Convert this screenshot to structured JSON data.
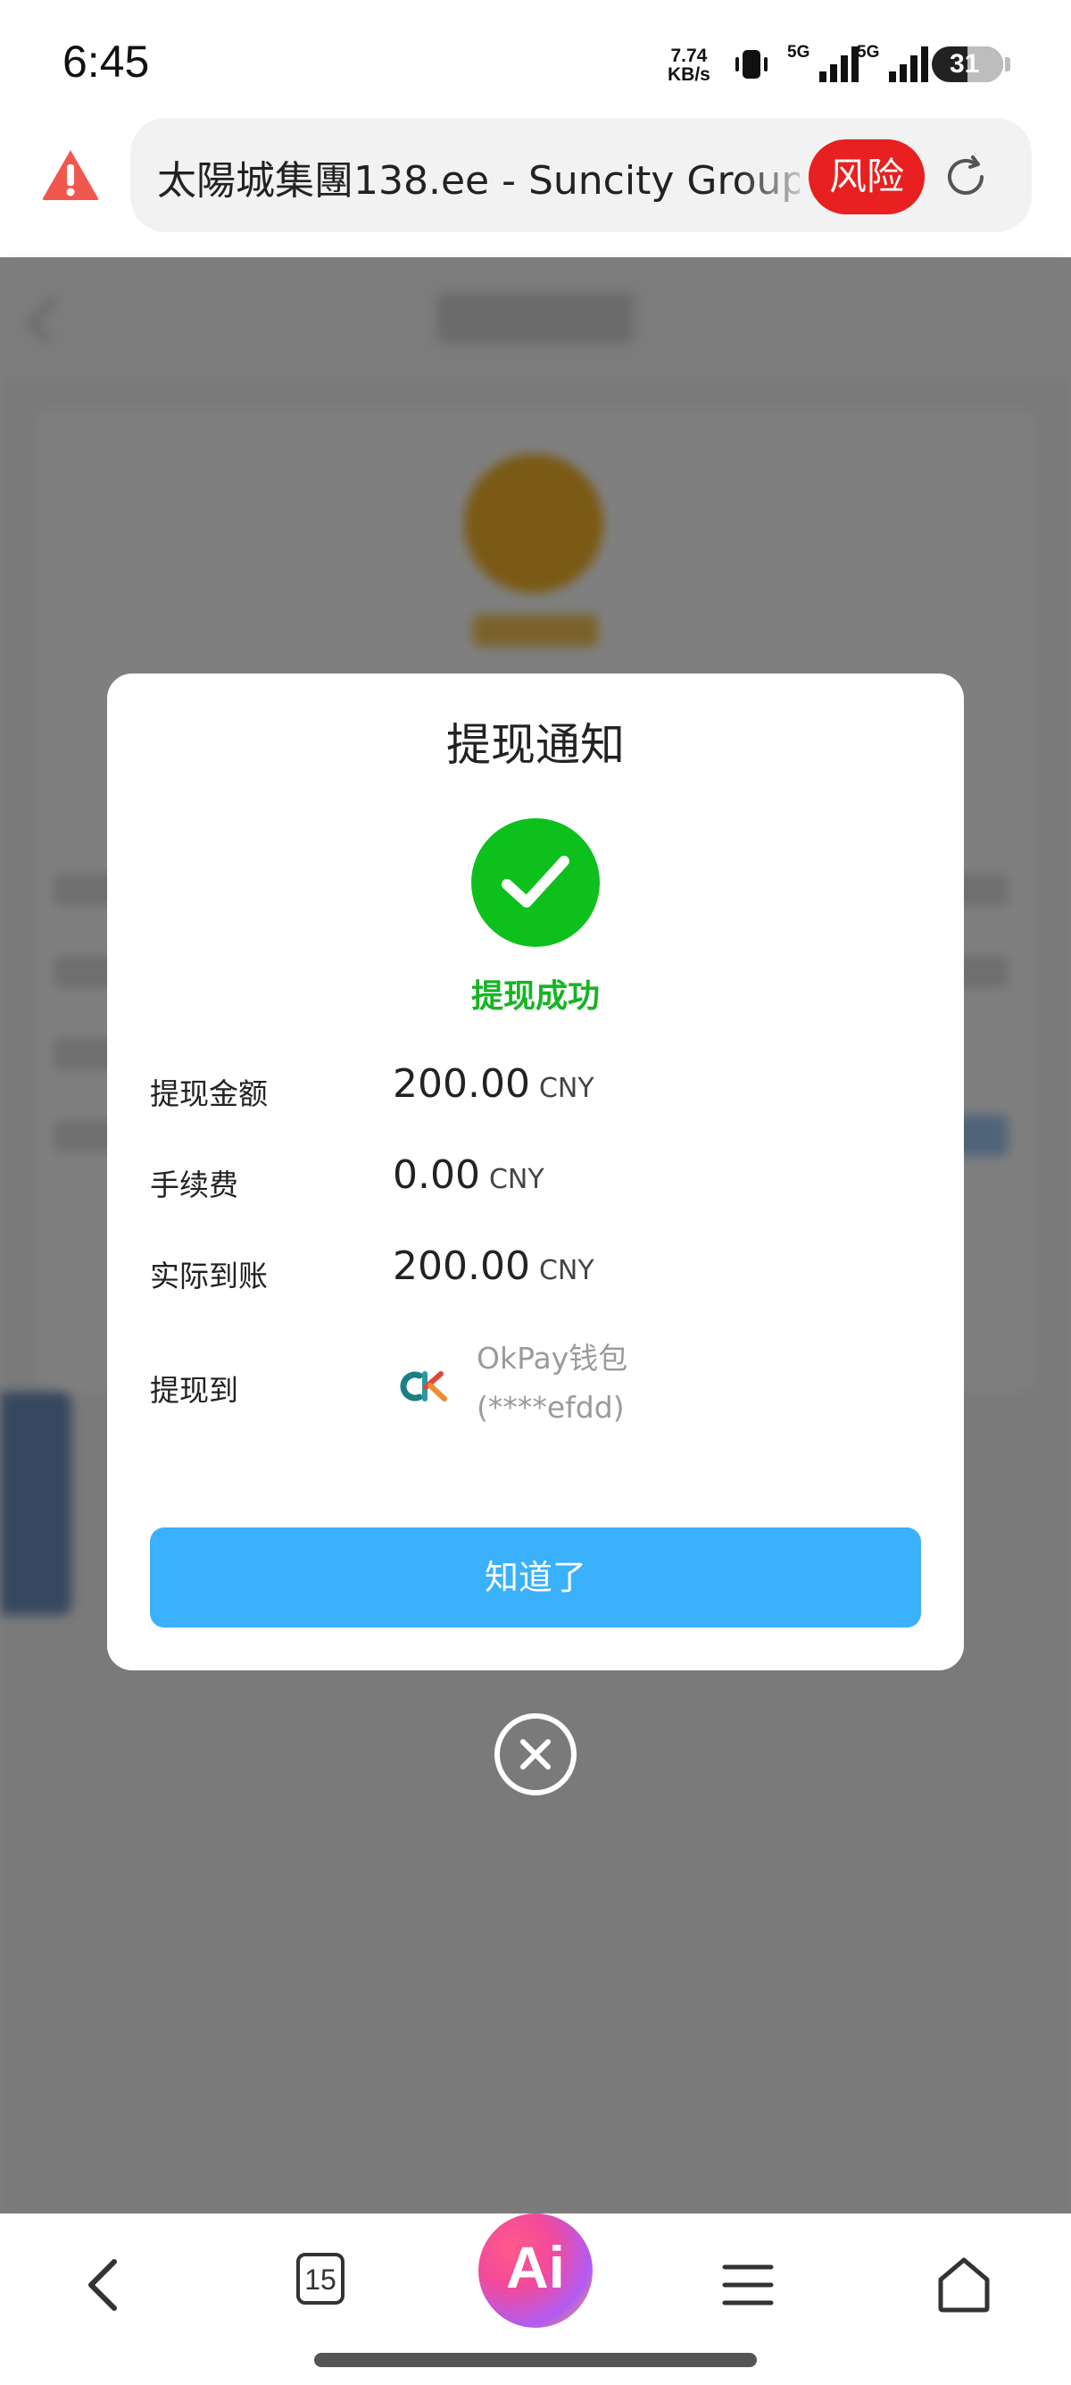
{
  "status_bar": {
    "time": "6:45",
    "net_speed_value": "7.74",
    "net_speed_unit": "KB/s",
    "network_1": "5G",
    "network_2": "5G",
    "battery": "31"
  },
  "browser": {
    "url_text": "太陽城集團138.ee - Suncity Group",
    "risk_label": "风险"
  },
  "modal": {
    "title": "提现通知",
    "status": "提现成功",
    "rows": [
      {
        "label": "提现金额",
        "value": "200.00",
        "currency": "CNY"
      },
      {
        "label": "手续费",
        "value": "0.00",
        "currency": "CNY"
      },
      {
        "label": "实际到账",
        "value": "200.00",
        "currency": "CNY"
      }
    ],
    "destination_label": "提现到",
    "wallet_name": "OkPay钱包",
    "wallet_account": "(****efdd)",
    "confirm_label": "知道了"
  },
  "bottom_nav": {
    "tabs_count": "15",
    "ai_label": "Ai"
  },
  "colors": {
    "success_green": "#0dc01c",
    "confirm_blue": "#3bb0fb",
    "risk_red": "#e8201f"
  }
}
